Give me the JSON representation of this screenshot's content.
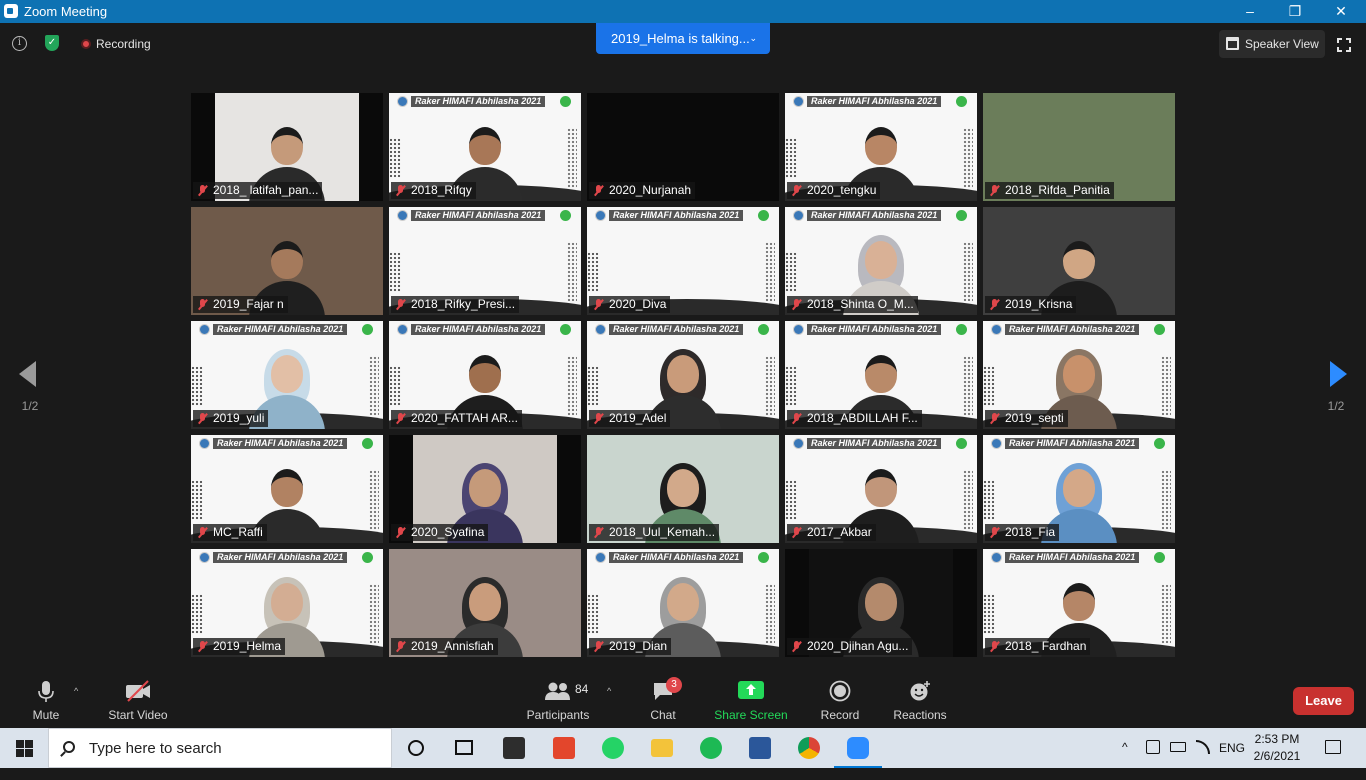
{
  "window": {
    "title": "Zoom Meeting",
    "controls": [
      "–",
      "❐",
      "✕"
    ]
  },
  "topbar": {
    "recording_label": "Recording",
    "talking_label": "2019_Helma is talking...",
    "speaker_view_label": "Speaker View"
  },
  "banner_text": "Raker HIMAFI Abhilasha 2021",
  "participants": [
    {
      "name": "2018_ latifah_pan..."
    },
    {
      "name": "2018_Rifqy"
    },
    {
      "name": "2020_Nurjanah"
    },
    {
      "name": "2020_tengku"
    },
    {
      "name": "2018_Rifda_Panitia"
    },
    {
      "name": "2019_Fajar n"
    },
    {
      "name": "2018_Rifky_Presi..."
    },
    {
      "name": "2020_Diva"
    },
    {
      "name": "2018_Shinta O_M..."
    },
    {
      "name": "2019_Krisna"
    },
    {
      "name": "2019_yuli"
    },
    {
      "name": "2020_FATTAH AR..."
    },
    {
      "name": "2019_Adel"
    },
    {
      "name": "2018_ABDILLAH F..."
    },
    {
      "name": "2019_septi"
    },
    {
      "name": "MC_Raffi"
    },
    {
      "name": "2020_Syafina"
    },
    {
      "name": "2018_Uul_Kemah..."
    },
    {
      "name": "2017_Akbar"
    },
    {
      "name": "2018_Fia"
    },
    {
      "name": "2019_Helma"
    },
    {
      "name": "2019_Annisfiah"
    },
    {
      "name": "2019_Dian"
    },
    {
      "name": "2020_Djihan Agu..."
    },
    {
      "name": "2018_ Fardhan"
    }
  ],
  "pagination": {
    "left_label": "1/2",
    "right_label": "1/2"
  },
  "controls": {
    "mute": "Mute",
    "start_video": "Start Video",
    "participants": "Participants",
    "participants_count": "84",
    "chat": "Chat",
    "chat_badge": "3",
    "share_screen": "Share Screen",
    "record": "Record",
    "reactions": "Reactions",
    "leave": "Leave"
  },
  "taskbar": {
    "search_placeholder": "Type here to search",
    "language": "ENG",
    "time": "2:53 PM",
    "date": "2/6/2021"
  },
  "colors": {
    "title_bar": "#0e72b3",
    "accent_blue": "#2d8cff",
    "share_green": "#23d959",
    "leave_red": "#c8312f",
    "muted_red": "#e0474b"
  }
}
